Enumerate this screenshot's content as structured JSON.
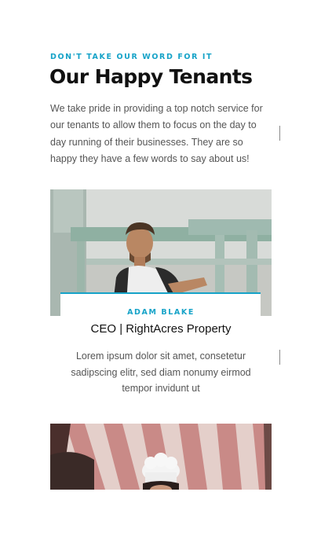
{
  "testimonials_section": {
    "eyebrow": "DON'T TAKE OUR WORD FOR IT",
    "title": "Our Happy Tenants",
    "intro": "We take pride in providing a top notch service for our tenants to allow them to focus on the day to day running of their businesses. They are so happy they have a few words to say about us!"
  },
  "testimonials": [
    {
      "name": "ADAM BLAKE",
      "role": "CEO | RightAcres Property",
      "quote": "Lorem ipsum dolor sit amet, consetetur sadipscing elitr, sed diam nonumy eirmod tempor invidunt ut"
    }
  ],
  "colors": {
    "accent": "#16a3c8",
    "heading": "#111111",
    "body_text": "#555555"
  }
}
